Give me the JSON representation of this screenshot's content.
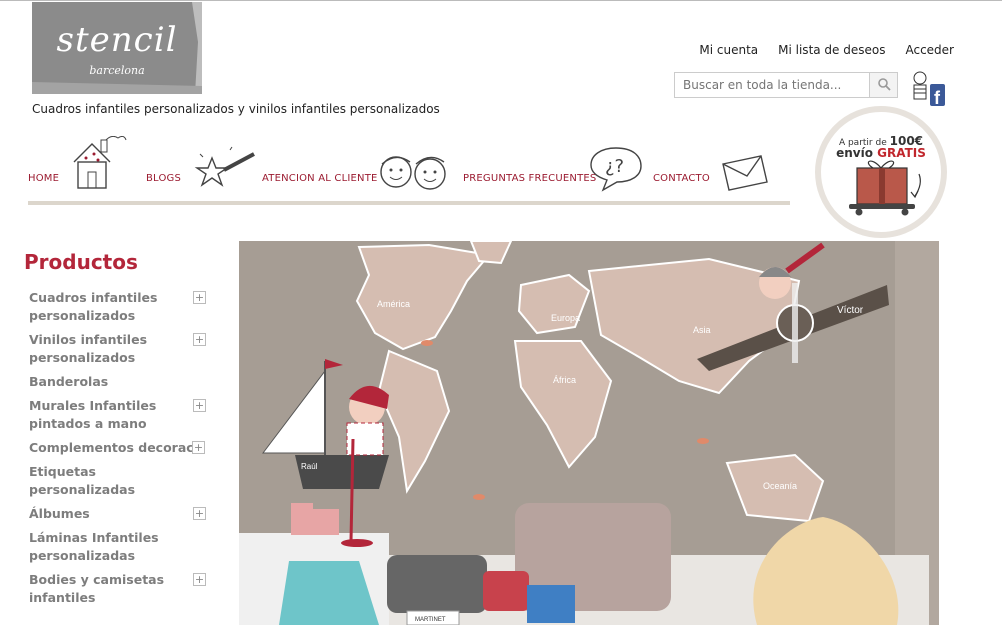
{
  "brand": {
    "logo_word": "stencil",
    "logo_city": "barcelona"
  },
  "tagline": "Cuadros infantiles personalizados y vinilos infantiles personalizados",
  "account_links": [
    "Mi cuenta",
    "Mi lista de deseos",
    "Acceder"
  ],
  "search": {
    "placeholder": "Buscar en toda la tienda..."
  },
  "shipping_badge": {
    "line1_prefix": "A partir de",
    "amount": "100€",
    "line2_prefix": "envío",
    "line2_highlight": "GRATIS"
  },
  "nav": [
    "HOME",
    "BLOGS",
    "ATENCION AL CLIENTE",
    "PREGUNTAS FRECUENTES",
    "CONTACTO"
  ],
  "sidebar": {
    "title": "Productos",
    "items": [
      {
        "label": "Cuadros infantiles personalizados",
        "expandable": true
      },
      {
        "label": "Vinilos infantiles personalizados",
        "expandable": true
      },
      {
        "label": "Banderolas",
        "expandable": false
      },
      {
        "label": "Murales Infantiles pintados a mano",
        "expandable": true
      },
      {
        "label": "Complementos decoración",
        "expandable": true
      },
      {
        "label": "Etiquetas personalizadas",
        "expandable": false
      },
      {
        "label": "Álbumes",
        "expandable": true
      },
      {
        "label": "Láminas Infantiles personalizadas",
        "expandable": false
      },
      {
        "label": "Bodies y camisetas infantiles",
        "expandable": true
      }
    ]
  },
  "banner": {
    "map_labels": [
      "América",
      "Europa",
      "Asia",
      "África",
      "Oceanía"
    ],
    "name_plane": "Víctor",
    "name_boat": "Raúl",
    "book_label": "MARTINET"
  },
  "colors": {
    "accent": "#b3263a",
    "nav_text": "#9b1b30",
    "menu_text": "#7d7d7d",
    "wall": "#a69d94",
    "continent": "#d5bdb1"
  }
}
